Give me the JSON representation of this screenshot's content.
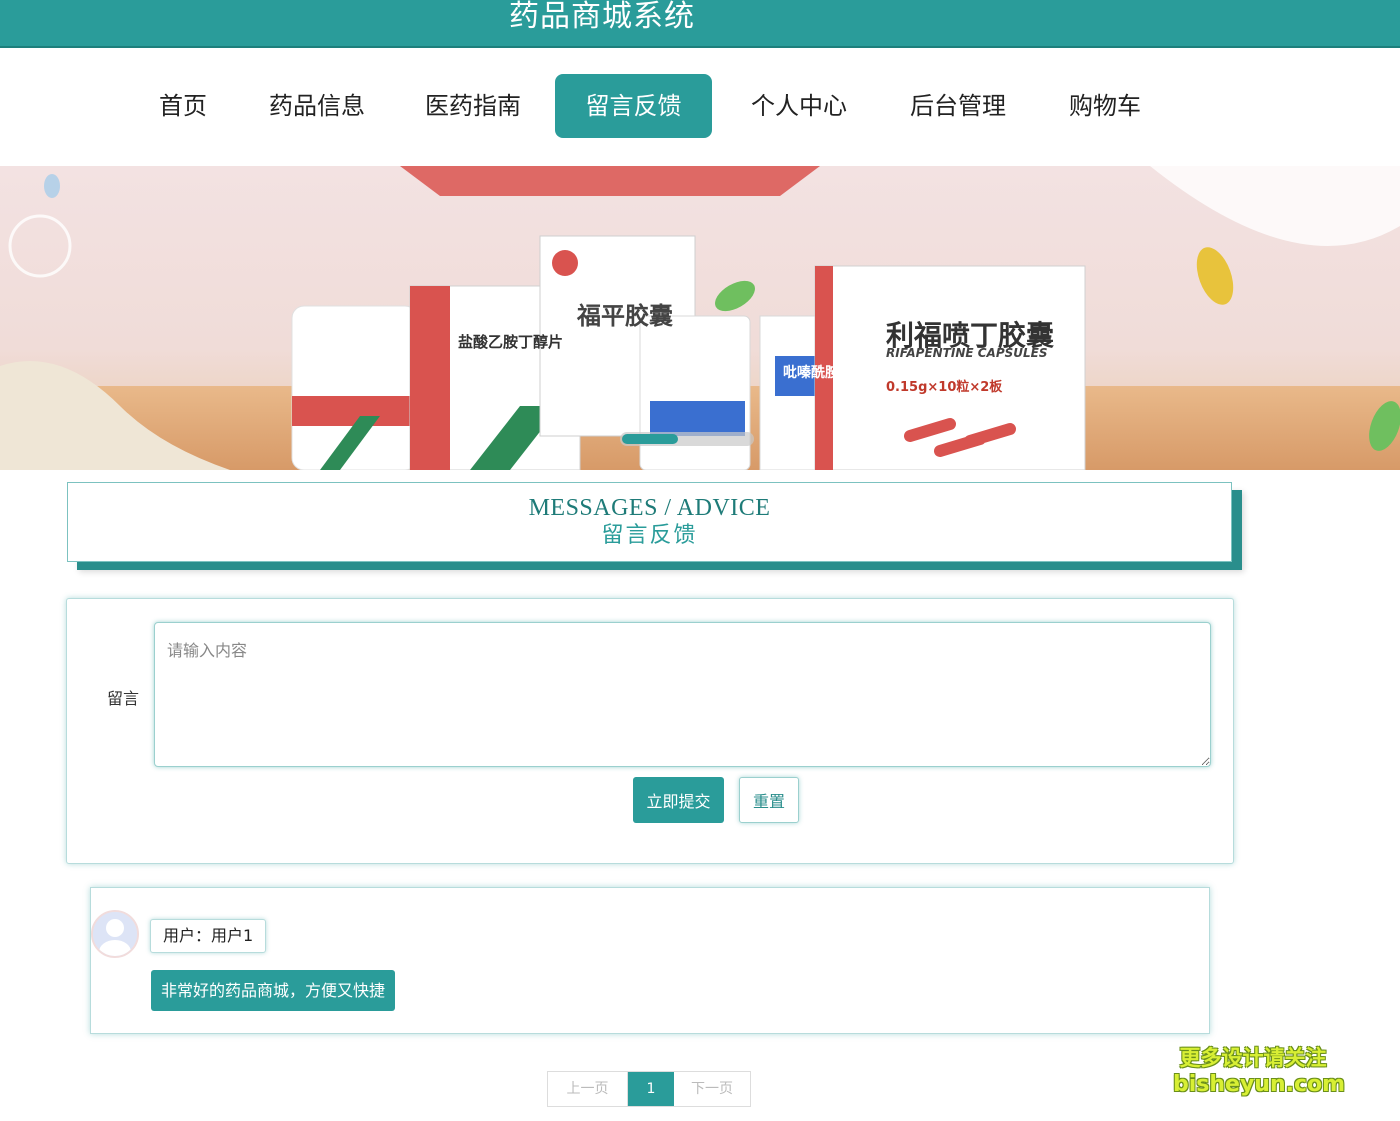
{
  "app": {
    "title": "药品商城系统"
  },
  "nav": {
    "items": [
      {
        "label": "首页"
      },
      {
        "label": "药品信息"
      },
      {
        "label": "医药指南"
      },
      {
        "label": "留言反馈"
      },
      {
        "label": "个人中心"
      },
      {
        "label": "后台管理"
      },
      {
        "label": "购物车"
      }
    ],
    "active": "留言反馈"
  },
  "banner": {
    "products": [
      "盐酸乙胺丁醇片",
      "福平胶囊",
      "吡嗪酰胺片",
      "利福喷丁胶囊",
      "RIFAPENTINE CAPSULES",
      "0.15g×10粒×2板"
    ]
  },
  "section": {
    "title_en": "MESSAGES / ADVICE",
    "title_cn": "留言反馈"
  },
  "form": {
    "label": "留言",
    "placeholder": "请输入内容",
    "value": "",
    "submit_label": "立即提交",
    "reset_label": "重置"
  },
  "messages": [
    {
      "user": "用户：用户1",
      "content": "非常好的药品商城，方便又快捷"
    }
  ],
  "pagination": {
    "prev": "上一页",
    "current": "1",
    "next": "下一页"
  },
  "watermark": {
    "line1": "更多设计请关注",
    "line2": "bisheyun.com"
  },
  "colors": {
    "primary": "#2a9c9a",
    "primary_dark": "#1e7b78"
  }
}
